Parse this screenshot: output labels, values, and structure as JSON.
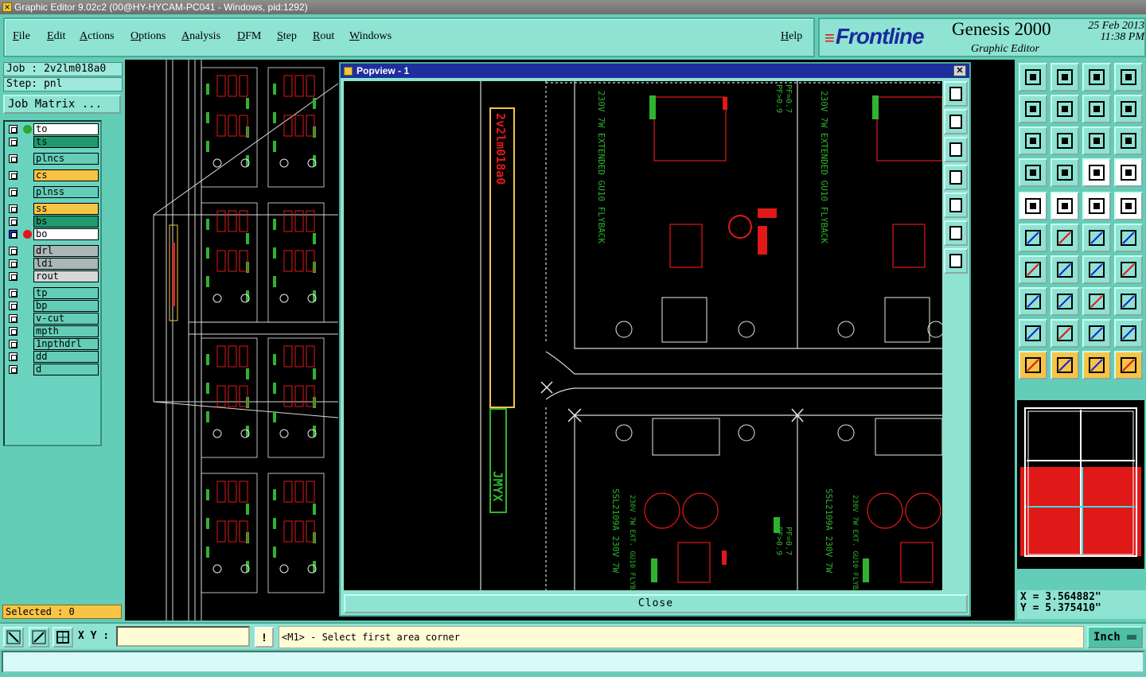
{
  "window": {
    "title": "Graphic Editor 9.02c2 (00@HY-HYCAM-PC041 - Windows, pid:1292)"
  },
  "menu": {
    "items": [
      "File",
      "Edit",
      "Actions",
      "Options",
      "Analysis",
      "DFM",
      "Step",
      "Rout",
      "Windows"
    ],
    "help": "Help"
  },
  "brand": {
    "logo": "Frontline",
    "product": "Genesis 2000",
    "subtitle": "Graphic Editor",
    "date": "25 Feb 2013",
    "time": "11:38 PM"
  },
  "job": {
    "job_label": "Job : 2v2lm018a0",
    "step_label": "Step: pnl",
    "matrix_button": "Job Matrix ..."
  },
  "layers": [
    {
      "name": "to",
      "bg": "#ffffff",
      "dot": "#2ca82c"
    },
    {
      "name": "ts",
      "bg": "#1e9a6e",
      "dot": ""
    },
    {
      "name": "plncs",
      "bg": "#64cdb8",
      "dot": ""
    },
    {
      "name": "cs",
      "bg": "#f7c445",
      "dot": ""
    },
    {
      "name": "plnss",
      "bg": "#64cdb8",
      "dot": ""
    },
    {
      "name": "ss",
      "bg": "#f7c445",
      "dot": ""
    },
    {
      "name": "bs",
      "bg": "#1e9a6e",
      "dot": ""
    },
    {
      "name": "bo",
      "bg": "#ffffff",
      "dot": "#e01818",
      "active": true
    },
    {
      "name": "drl",
      "bg": "#a9b7b5",
      "dot": ""
    },
    {
      "name": "ldi",
      "bg": "#a9b7b5",
      "dot": ""
    },
    {
      "name": "rout",
      "bg": "#d7d7d7",
      "dot": ""
    },
    {
      "name": "tp",
      "bg": "#64cdb8",
      "dot": ""
    },
    {
      "name": "bp",
      "bg": "#64cdb8",
      "dot": ""
    },
    {
      "name": "v-cut",
      "bg": "#64cdb8",
      "dot": ""
    },
    {
      "name": "mpth",
      "bg": "#64cdb8",
      "dot": ""
    },
    {
      "name": "1npthdrl",
      "bg": "#64cdb8",
      "dot": ""
    },
    {
      "name": "dd",
      "bg": "#64cdb8",
      "dot": ""
    },
    {
      "name": "d",
      "bg": "#64cdb8",
      "dot": ""
    }
  ],
  "selection": {
    "label": "Selected : 0"
  },
  "popview": {
    "title": "Popview - 1",
    "close_label": "Close",
    "close_x": "✕"
  },
  "pcb_text": {
    "board_label": "230V 7W EXTENDED GU10 FLYBACK",
    "part_label": "SSL2109A 230V 7W",
    "ext_label": "230V 7W EXT. GU10 FLYBACK",
    "pf_label": "PF=0.7",
    "pf2_label": "PF>0.9",
    "panel_code": "2v2lm018a0",
    "panel_tag": "JMYX"
  },
  "coords": {
    "x": "X = 3.564882\"",
    "y": "Y = 5.375410\""
  },
  "bottom": {
    "xy_label": "X Y :",
    "xy_value": "",
    "warn": "!",
    "prompt": "<M1> - Select first area corner",
    "unit": "Inch"
  },
  "colors": {
    "accent": "#8fe3d3",
    "panel": "#64cdb8",
    "titlebar": "#1f2e9d",
    "pcb_green": "#2fb32f",
    "pcb_red": "#e01818",
    "pcb_white": "#e8e8e8",
    "highlight": "#f7c445"
  },
  "icons": {
    "tools": [
      "zoom-home-icon",
      "zoom-layer-icon",
      "home-icon",
      "window-split-icon",
      "pan-left-icon",
      "pan-right-icon",
      "redo-icon",
      "snap-icon",
      "fit-icon",
      "center-icon",
      "scale-1-2-icon",
      "help-icon",
      "settings-icon",
      "grid-icon",
      "layer-compare-icon",
      "layer-compare2-icon",
      "select-icon",
      "measure-icon",
      "ruler-icon",
      "circle-icon",
      "net-icon",
      "cross-icon",
      "point-icon",
      "pointer-icon",
      "line-icon",
      "diagonal-icon",
      "arc-icon",
      "route-icon",
      "pad-icon",
      "minus-icon",
      "bracket-icon",
      "dots-icon",
      "triangle-icon",
      "triangle2-icon",
      "triangle3-icon",
      "triangle4-icon",
      "arrow-icon",
      "arrow-box-icon",
      "arrow-dark-icon",
      "net-select-icon"
    ]
  }
}
